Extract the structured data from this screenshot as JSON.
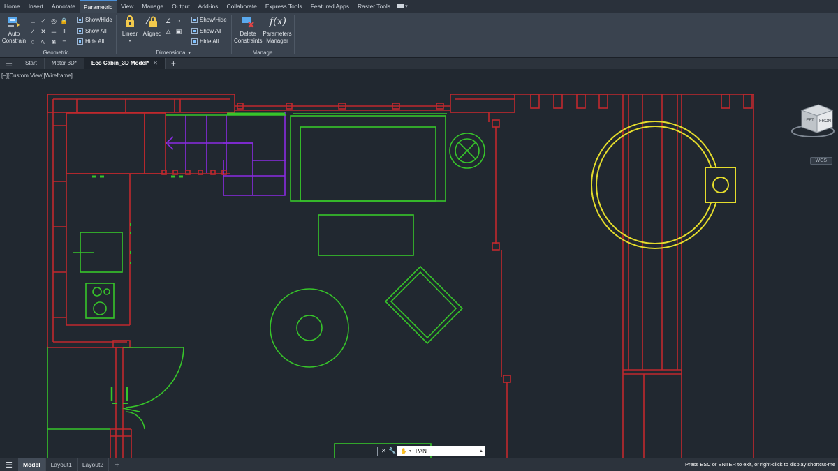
{
  "ribbon": {
    "tabs": [
      "Home",
      "Insert",
      "Annotate",
      "Parametric",
      "View",
      "Manage",
      "Output",
      "Add-ins",
      "Collaborate",
      "Express Tools",
      "Featured Apps",
      "Raster Tools"
    ],
    "active_tab": "Parametric",
    "geometric": {
      "title": "Geometric",
      "auto_constrain_line1": "Auto",
      "auto_constrain_line2": "Constrain",
      "show_hide": "Show/Hide",
      "show_all": "Show All",
      "hide_all": "Hide All"
    },
    "dimensional": {
      "title": "Dimensional",
      "linear": "Linear",
      "aligned": "Aligned",
      "show_hide": "Show/Hide",
      "show_all": "Show All",
      "hide_all": "Hide All"
    },
    "manage": {
      "title": "Manage",
      "delete_line1": "Delete",
      "delete_line2": "Constraints",
      "params_line1": "Parameters",
      "params_line2": "Manager",
      "fx_symbol": "f(x)"
    }
  },
  "file_tabs": {
    "items": [
      {
        "label": "Start",
        "active": false
      },
      {
        "label": "Motor 3D*",
        "active": false
      },
      {
        "label": "Eco Cabin_3D Model*",
        "active": true
      }
    ]
  },
  "viewport": {
    "label": "[−][Custom View][Wireframe]",
    "viewcube_left": "LEFT",
    "viewcube_front": "FRONT",
    "wcs": "WCS",
    "colors": {
      "walls": "#c0282d",
      "furniture": "#37c52a",
      "stairs": "#8a2be2",
      "table": "#e4dc2c",
      "background": "#212830"
    }
  },
  "command": {
    "text": "PAN"
  },
  "layout_tabs": {
    "items": [
      {
        "label": "Model",
        "active": true
      },
      {
        "label": "Layout1",
        "active": false
      },
      {
        "label": "Layout2",
        "active": false
      }
    ],
    "status": "Press ESC or ENTER to exit, or right-click to display shortcut-me"
  }
}
